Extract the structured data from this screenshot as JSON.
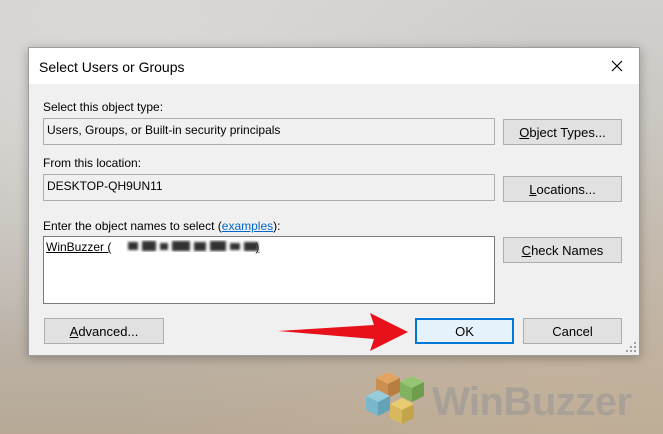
{
  "window": {
    "title": "Select Users or Groups"
  },
  "object_type": {
    "label": "Select this object type:",
    "value": "Users, Groups, or Built-in security principals",
    "button": "Object Types..."
  },
  "location": {
    "label": "From this location:",
    "value": "DESKTOP-QH9UN11",
    "button": "Locations..."
  },
  "names": {
    "label_prefix": "Enter the object names to select (",
    "link": "examples",
    "label_suffix": "):",
    "entry": "WinBuzzer (",
    "entry_close": ")",
    "check_button": "Check Names"
  },
  "footer": {
    "advanced": "Advanced...",
    "ok": "OK",
    "cancel": "Cancel"
  },
  "watermark": {
    "text": "WinBuzzer"
  },
  "colors": {
    "accent": "#0078d7",
    "arrow": "#e8101a",
    "link": "#0066cc"
  },
  "icons": [
    "close-icon",
    "resize-grip-icon",
    "red-arrow",
    "winbuzzer-logo"
  ]
}
